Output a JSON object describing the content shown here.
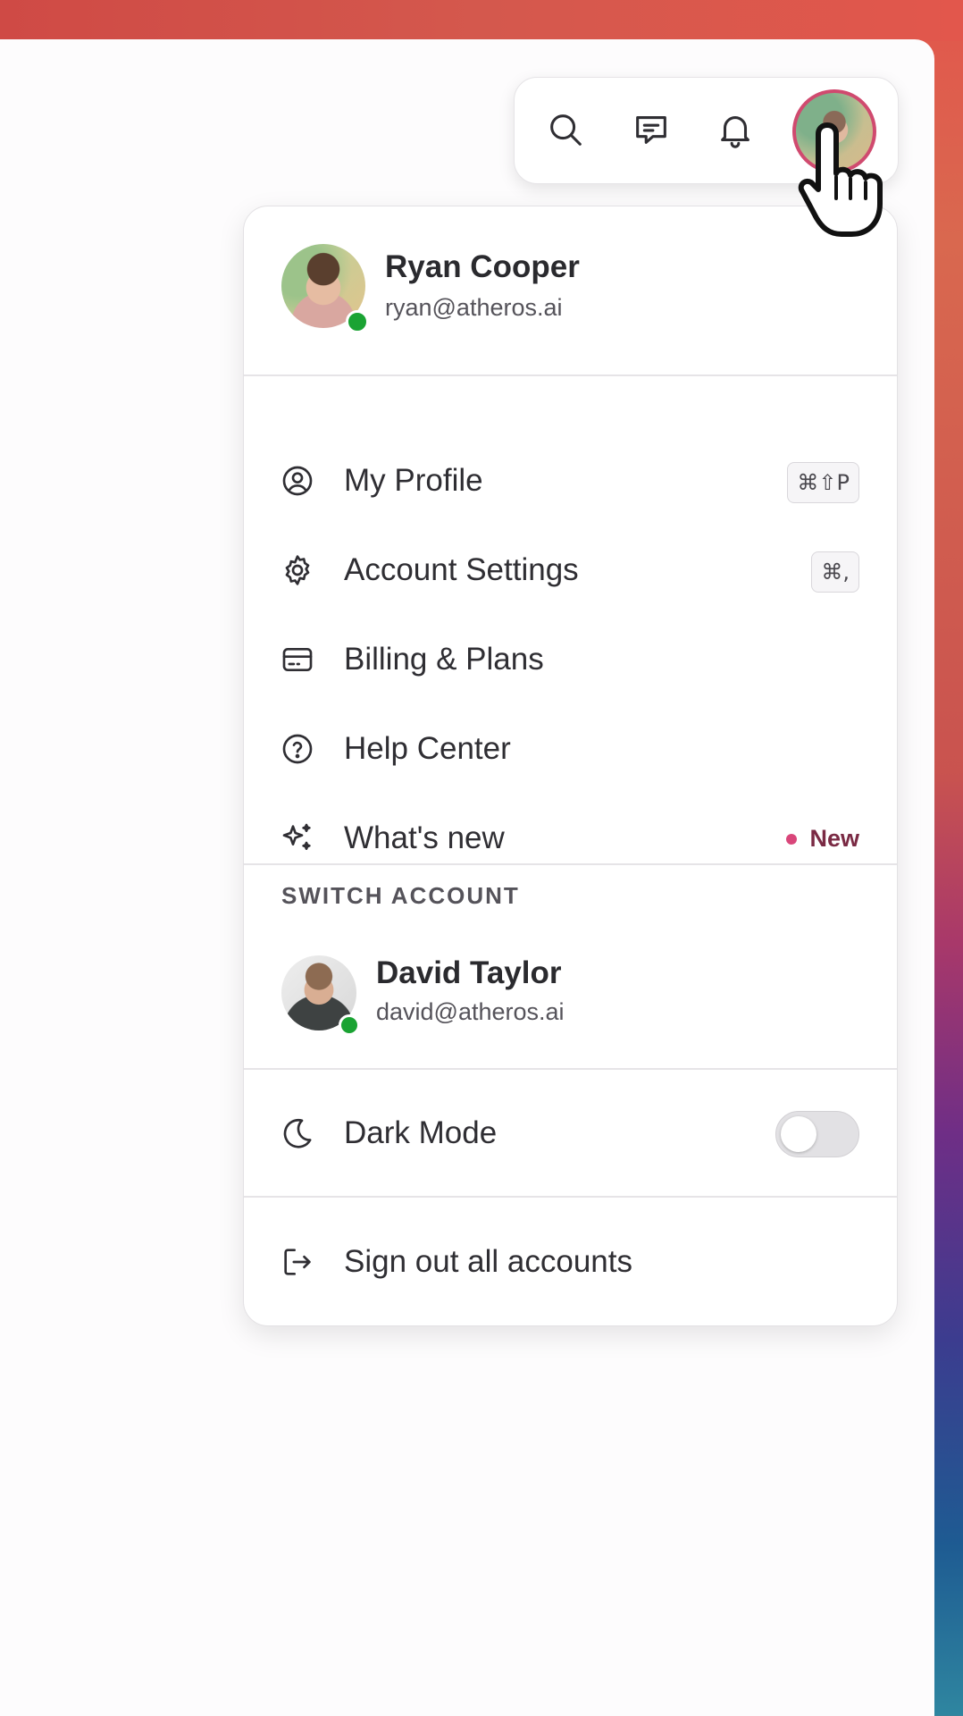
{
  "topbar": {
    "icons": [
      "search-icon",
      "chat-icon",
      "bell-icon"
    ]
  },
  "profile": {
    "name": "Ryan Cooper",
    "email": "ryan@atheros.ai",
    "status": "online"
  },
  "menu_items": [
    {
      "label": "My Profile",
      "icon": "user-circle-icon",
      "shortcut": "⌘⇧P"
    },
    {
      "label": "Account Settings",
      "icon": "gear-icon",
      "shortcut": "⌘,"
    },
    {
      "label": "Billing & Plans",
      "icon": "credit-card-icon"
    },
    {
      "label": "Help Center",
      "icon": "help-circle-icon"
    },
    {
      "label": "What's new",
      "icon": "sparkles-icon",
      "badge": "New"
    }
  ],
  "switch_account": {
    "section_label": "SWITCH ACCOUNT",
    "name": "David Taylor",
    "email": "david@atheros.ai",
    "status": "online"
  },
  "dark_mode": {
    "label": "Dark Mode",
    "enabled": false
  },
  "sign_out": {
    "label": "Sign out all accounts"
  },
  "colors": {
    "online": "#1aa333",
    "accent": "#d04a6f",
    "new_badge": "#7a2a44"
  }
}
